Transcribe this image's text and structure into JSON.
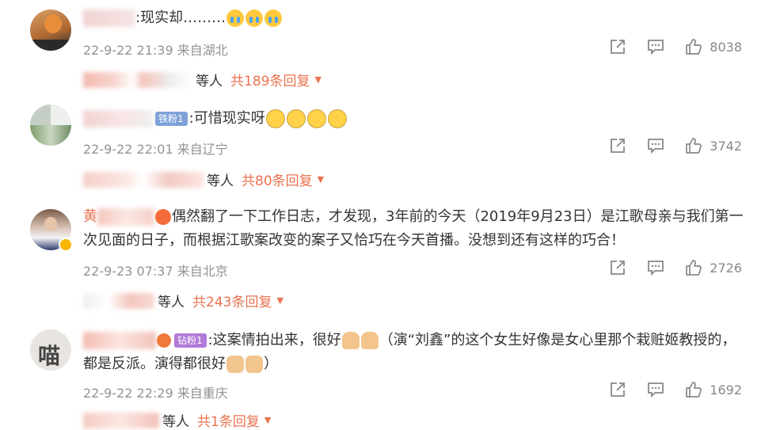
{
  "comments": [
    {
      "text": ":现实却………",
      "meta": "22-9-22 21:39 来自湖北",
      "likes": "8038",
      "reply_suffix": "等人",
      "reply_count": "共189条回复"
    },
    {
      "badge": "铁粉1",
      "text": ":可惜现实呀",
      "meta": "22-9-22 22:01 来自辽宁",
      "likes": "3742",
      "reply_suffix": "等人",
      "reply_count": "共80条回复"
    },
    {
      "name_visible": "黄",
      "text": "偶然翻了一下工作日志，才发现，3年前的今天（2019年9月23日）是江歌母亲与我们第一次见面的日子，而根据江歌案改变的案子又恰巧在今天首播。没想到还有这样的巧合！",
      "meta": "22-9-23 07:37 来自北京",
      "likes": "2726",
      "reply_suffix": "等人",
      "reply_count": "共243条回复"
    },
    {
      "badge": "钻粉1",
      "text_a": ":这案情拍出来，很好",
      "text_b": "（演“刘鑫”的这个女生好像是女心里那个栽赃姬教授的，都是反派。演得都很好",
      "text_c": "）",
      "meta": "22-9-22 22:29 来自重庆",
      "likes": "1692",
      "avatar_char": "喵",
      "reply_suffix": "等人",
      "reply_count": "共1条回复"
    }
  ],
  "icons": [
    "share-icon",
    "comment-icon",
    "like-icon",
    "chevron-down-icon"
  ],
  "colors": {
    "accent": "#eb7350",
    "meta": "#939393",
    "text": "#333333"
  }
}
